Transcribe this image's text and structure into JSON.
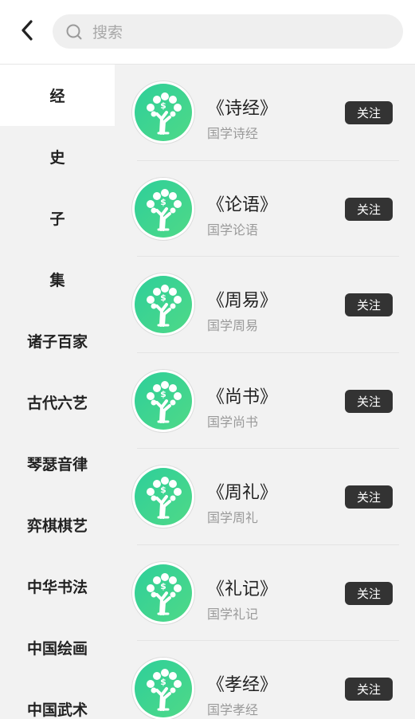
{
  "search": {
    "placeholder": "搜索"
  },
  "colors": {
    "accent": "#3fd08c",
    "button_bg": "#333333",
    "active_bg": "#ffffff"
  },
  "sidebar": {
    "active_index": 0,
    "items": [
      {
        "label": "经"
      },
      {
        "label": "史"
      },
      {
        "label": "子"
      },
      {
        "label": "集"
      },
      {
        "label": "诸子百家"
      },
      {
        "label": "古代六艺"
      },
      {
        "label": "琴瑟音律"
      },
      {
        "label": "弈棋棋艺"
      },
      {
        "label": "中华书法"
      },
      {
        "label": "中国绘画"
      },
      {
        "label": "中国武术"
      }
    ]
  },
  "items": [
    {
      "title": "《诗经》",
      "subtitle": "国学诗经",
      "button": "关注"
    },
    {
      "title": "《论语》",
      "subtitle": "国学论语",
      "button": "关注"
    },
    {
      "title": "《周易》",
      "subtitle": "国学周易",
      "button": "关注"
    },
    {
      "title": "《尚书》",
      "subtitle": "国学尚书",
      "button": "关注"
    },
    {
      "title": "《周礼》",
      "subtitle": "国学周礼",
      "button": "关注"
    },
    {
      "title": "《礼记》",
      "subtitle": "国学礼记",
      "button": "关注"
    },
    {
      "title": "《孝经》",
      "subtitle": "国学孝经",
      "button": "关注"
    }
  ]
}
